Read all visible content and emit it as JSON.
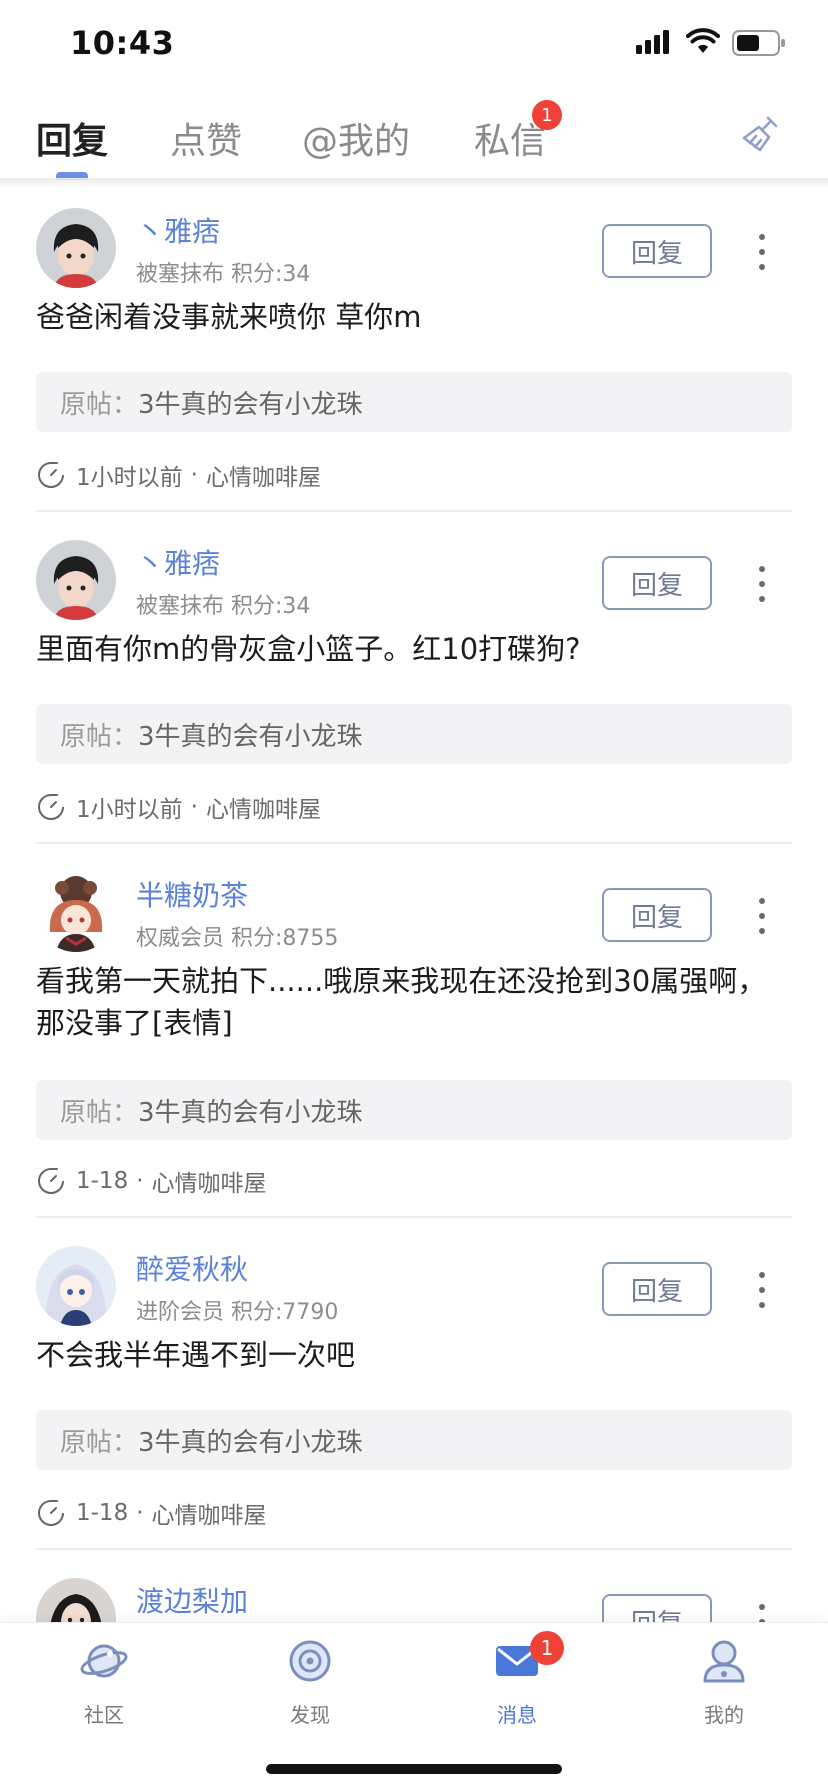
{
  "status_bar": {
    "time": "10:43"
  },
  "top_tabs": {
    "tabs": [
      {
        "label": "回复",
        "active": true
      },
      {
        "label": "点赞",
        "active": false
      },
      {
        "label": "@我的",
        "active": false
      },
      {
        "label": "私信",
        "active": false,
        "badge": "1"
      }
    ],
    "accent_color": "#6f8ee6"
  },
  "messages": [
    {
      "name": "丶雅痞",
      "level": "被塞抹布",
      "score": "积分:34",
      "reply_label": "回复",
      "content": "爸爸闲着没事就来喷你 草你m",
      "orig_label": "原帖：",
      "orig_title": "3牛真的会有小龙珠",
      "time": "1小时以前",
      "separator": "·",
      "board": "心情咖啡屋"
    },
    {
      "name": "丶雅痞",
      "level": "被塞抹布",
      "score": "积分:34",
      "reply_label": "回复",
      "content": "里面有你m的骨灰盒小篮子。红10打碟狗?",
      "orig_label": "原帖：",
      "orig_title": "3牛真的会有小龙珠",
      "time": "1小时以前",
      "separator": "·",
      "board": "心情咖啡屋"
    },
    {
      "name": "半糖奶茶",
      "level": "权威会员",
      "score": "积分:8755",
      "reply_label": "回复",
      "content": "看我第一天就拍下......哦原来我现在还没抢到30属强啊，那没事了[表情]",
      "orig_label": "原帖：",
      "orig_title": "3牛真的会有小龙珠",
      "time": "1-18",
      "separator": "·",
      "board": "心情咖啡屋"
    },
    {
      "name": "醉爱秋秋",
      "level": "进阶会员",
      "score": "积分:7790",
      "reply_label": "回复",
      "content": "不会我半年遇不到一次吧",
      "orig_label": "原帖：",
      "orig_title": "3牛真的会有小龙珠",
      "time": "1-18",
      "separator": "·",
      "board": "心情咖啡屋"
    },
    {
      "name": "渡边梨加",
      "reply_label": "回复"
    }
  ],
  "bottom_nav": {
    "items": [
      {
        "label": "社区",
        "icon": "planet-icon"
      },
      {
        "label": "发现",
        "icon": "discover-icon"
      },
      {
        "label": "消息",
        "icon": "mail-icon",
        "badge": "1",
        "active": true
      },
      {
        "label": "我的",
        "icon": "profile-icon"
      }
    ],
    "active_color": "#4a78d8"
  },
  "colors": {
    "username": "#5b82d9",
    "badge": "#f04136"
  }
}
